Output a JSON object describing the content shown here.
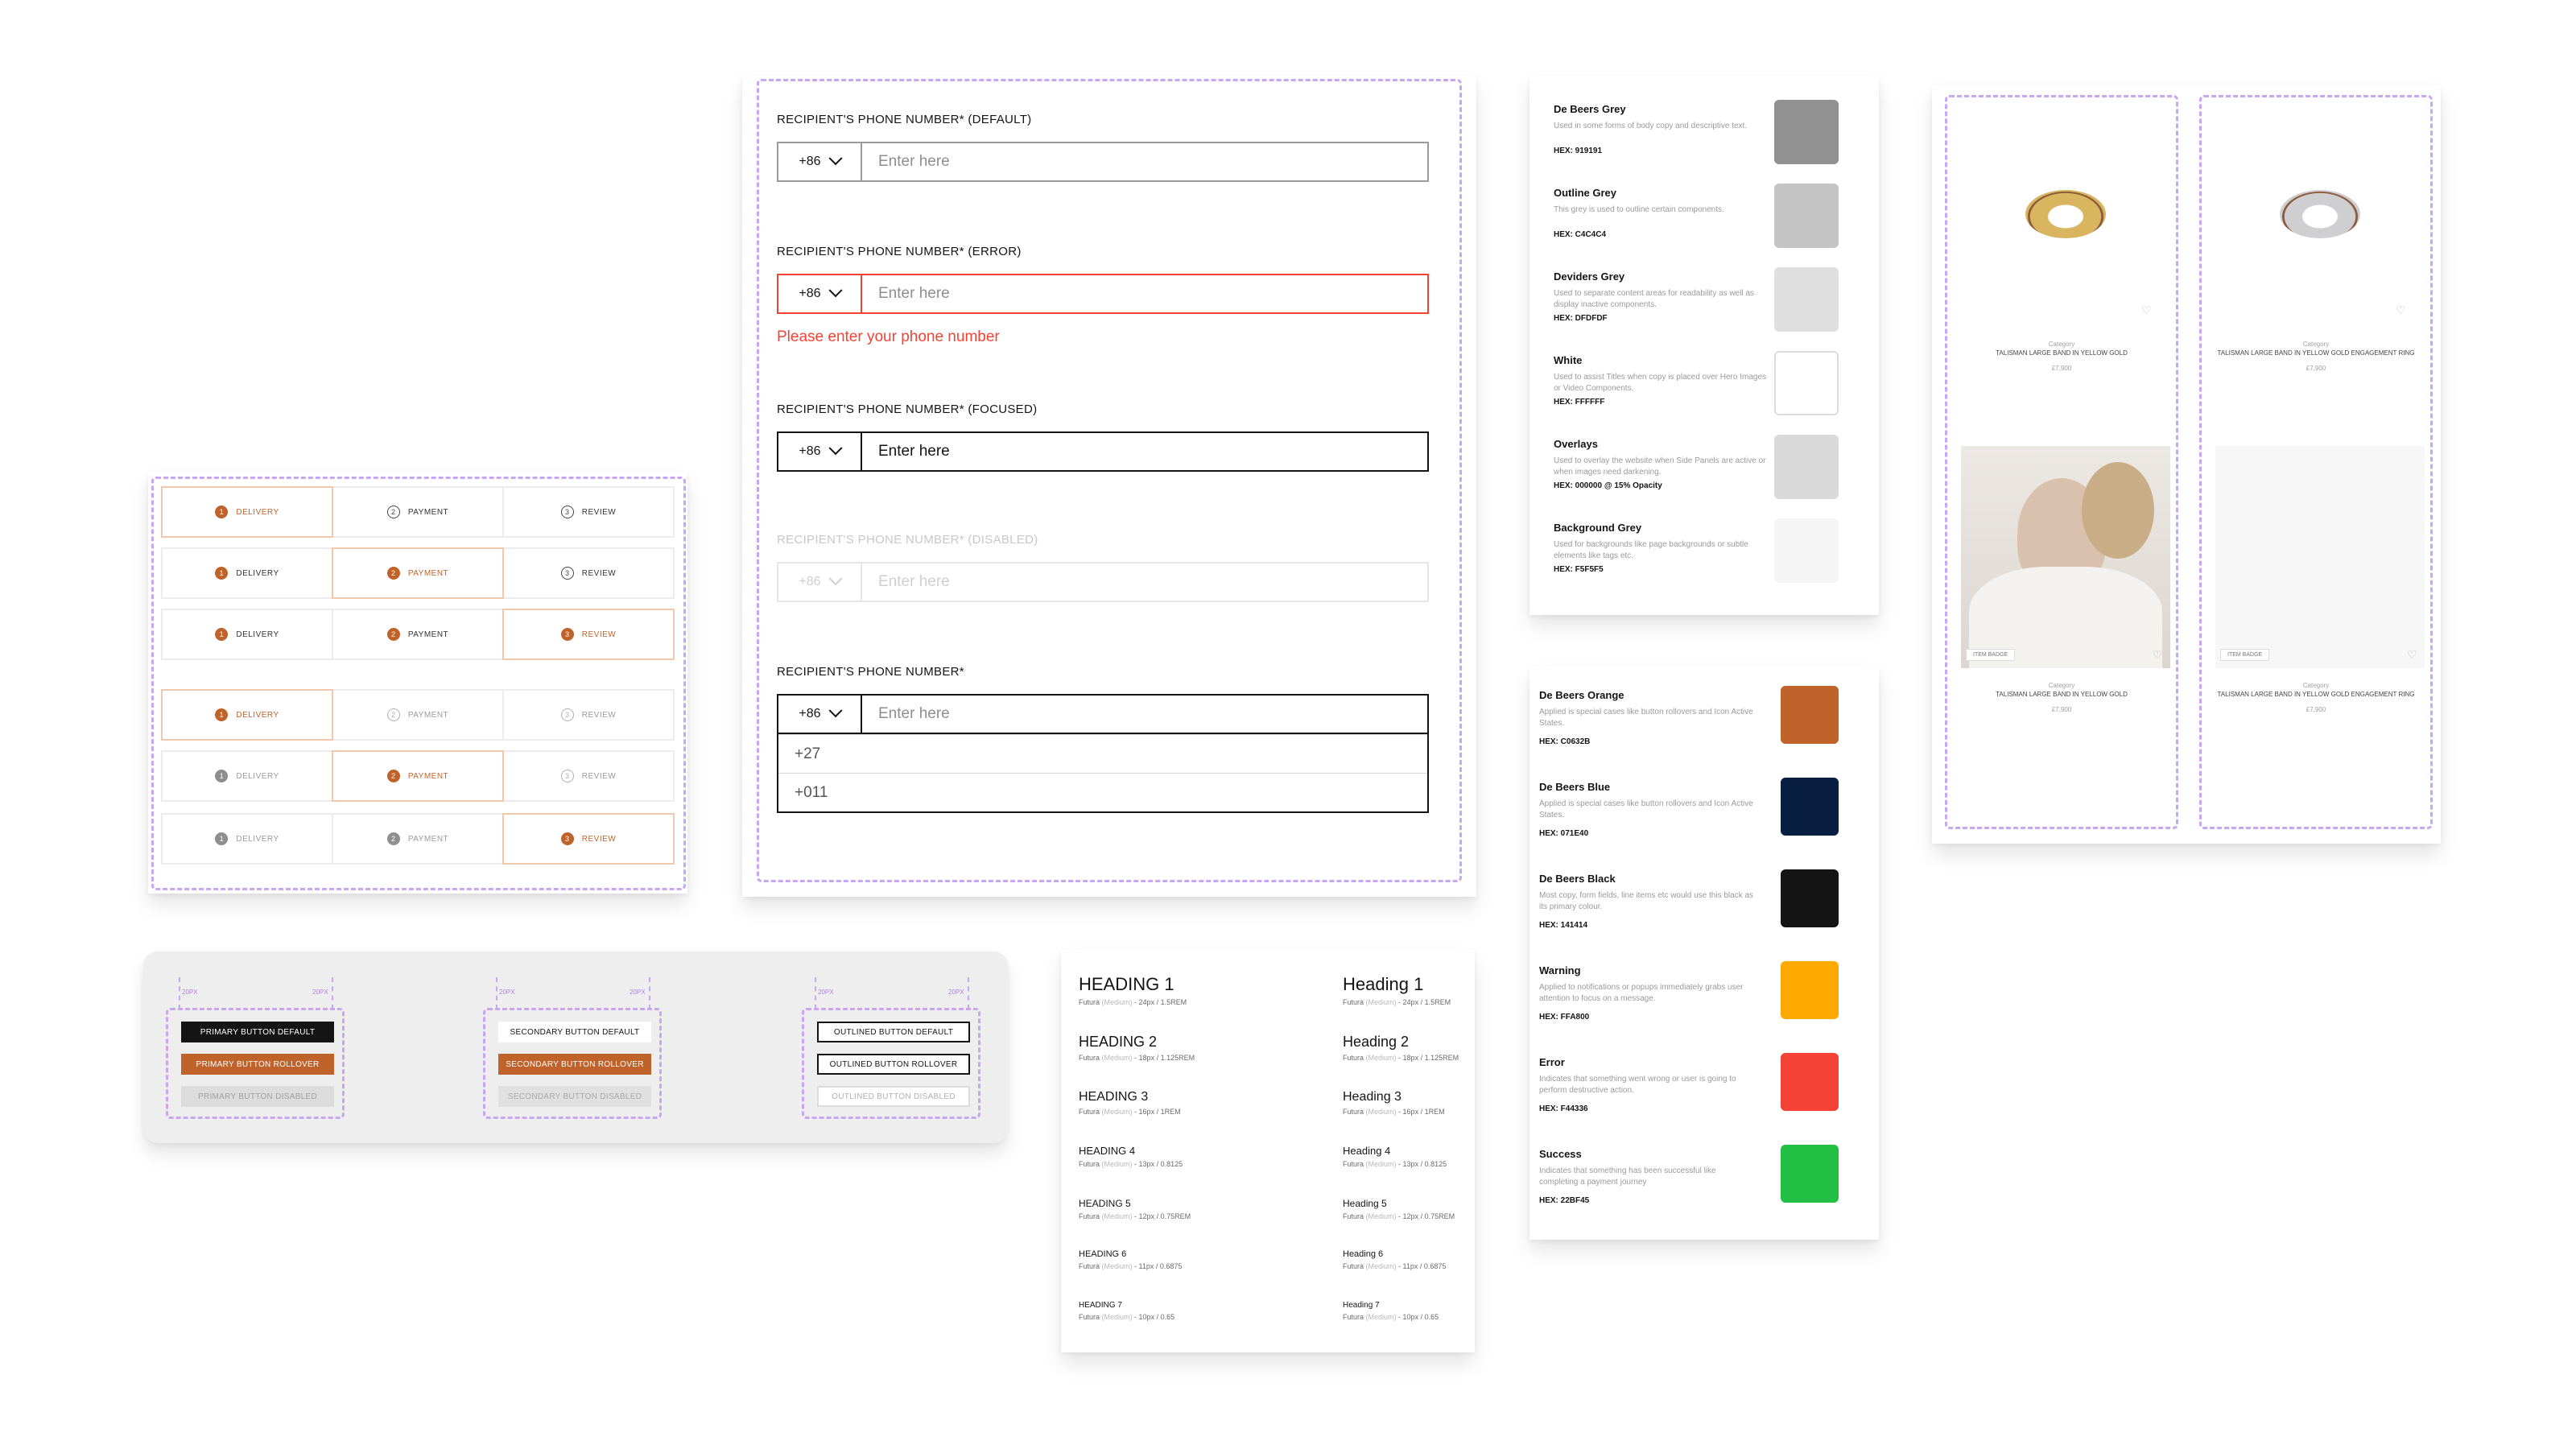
{
  "stepper": {
    "rows": [
      {
        "steps": [
          {
            "num": "1",
            "label": "DELIVERY",
            "state": "active",
            "icon": "filled"
          },
          {
            "num": "2",
            "label": "PAYMENT",
            "state": "default",
            "icon": "outline"
          },
          {
            "num": "3",
            "label": "REVIEW",
            "state": "default",
            "icon": "outline"
          }
        ]
      },
      {
        "steps": [
          {
            "num": "1",
            "label": "DELIVERY",
            "state": "done",
            "icon": "filled"
          },
          {
            "num": "2",
            "label": "PAYMENT",
            "state": "active",
            "icon": "filled"
          },
          {
            "num": "3",
            "label": "REVIEW",
            "state": "default",
            "icon": "outline"
          }
        ]
      },
      {
        "steps": [
          {
            "num": "1",
            "label": "DELIVERY",
            "state": "done",
            "icon": "filled"
          },
          {
            "num": "2",
            "label": "PAYMENT",
            "state": "done",
            "icon": "filled"
          },
          {
            "num": "3",
            "label": "REVIEW",
            "state": "active",
            "icon": "filled"
          }
        ]
      },
      {
        "steps": [
          {
            "num": "1",
            "label": "DELIVERY",
            "state": "active",
            "icon": "filled"
          },
          {
            "num": "2",
            "label": "PAYMENT",
            "state": "muted",
            "icon": "outline-light"
          },
          {
            "num": "3",
            "label": "REVIEW",
            "state": "muted",
            "icon": "outline-light"
          }
        ]
      },
      {
        "steps": [
          {
            "num": "1",
            "label": "DELIVERY",
            "state": "muted",
            "icon": "grey"
          },
          {
            "num": "2",
            "label": "PAYMENT",
            "state": "active",
            "icon": "filled"
          },
          {
            "num": "3",
            "label": "REVIEW",
            "state": "muted",
            "icon": "outline-light"
          }
        ]
      },
      {
        "steps": [
          {
            "num": "1",
            "label": "DELIVERY",
            "state": "muted",
            "icon": "grey"
          },
          {
            "num": "2",
            "label": "PAYMENT",
            "state": "muted",
            "icon": "grey"
          },
          {
            "num": "3",
            "label": "REVIEW",
            "state": "active",
            "icon": "filled"
          }
        ]
      }
    ]
  },
  "phone_form": {
    "default": {
      "label": "RECIPIENT'S PHONE NUMBER* (DEFAULT)",
      "code": "+86",
      "placeholder": "Enter here"
    },
    "error": {
      "label": "RECIPIENT'S PHONE NUMBER* (ERROR)",
      "code": "+86",
      "placeholder": "Enter here",
      "message": "Please enter your phone number"
    },
    "focused": {
      "label": "RECIPIENT'S PHONE NUMBER* (FOCUSED)",
      "code": "+86",
      "value": "Enter here"
    },
    "disabled": {
      "label": "RECIPIENT'S PHONE NUMBER* (DISABLED)",
      "code": "+86",
      "placeholder": "Enter here"
    },
    "open": {
      "label": "RECIPIENT'S PHONE NUMBER*",
      "code": "+86",
      "placeholder": "Enter here",
      "options": [
        "+27",
        "+011"
      ]
    }
  },
  "buttons": {
    "spacing_label": "20PX",
    "primary": {
      "default": "PRIMARY BUTTON DEFAULT",
      "rollover": "PRIMARY BUTTON ROLLOVER",
      "disabled": "PRIMARY BUTTON DISABLED"
    },
    "secondary": {
      "default": "SECONDARY BUTTON DEFAULT",
      "rollover": "SECONDARY BUTTON ROLLOVER",
      "disabled": "SECONDARY BUTTON DISABLED"
    },
    "outlined": {
      "default": "OUTLINED BUTTON DEFAULT",
      "rollover": "OUTLINED BUTTON ROLLOVER",
      "disabled": "OUTLINED BUTTON DISABLED"
    }
  },
  "typography": {
    "upper": [
      {
        "title": "HEADING 1",
        "font": "Futura",
        "weight": "(Medium)",
        "size": "24px / 1.5REM"
      },
      {
        "title": "HEADING 2",
        "font": "Futura",
        "weight": "(Medium)",
        "size": "18px / 1.125REM"
      },
      {
        "title": "HEADING 3",
        "font": "Futura",
        "weight": "(Medium)",
        "size": "16px / 1REM"
      },
      {
        "title": "HEADING 4",
        "font": "Futura",
        "weight": "(Medium)",
        "size": "13px / 0.8125"
      },
      {
        "title": "HEADING 5",
        "font": "Futura",
        "weight": "(Medium)",
        "size": "12px / 0.75REM"
      },
      {
        "title": "HEADING 6",
        "font": "Futura",
        "weight": "(Medium)",
        "size": "11px / 0.6875"
      },
      {
        "title": "HEADING 7",
        "font": "Futura",
        "weight": "(Medium)",
        "size": "10px / 0.65"
      }
    ],
    "title_case": [
      {
        "title": "Heading 1",
        "font": "Futura",
        "weight": "(Medium)",
        "size": "24px / 1.5REM"
      },
      {
        "title": "Heading 2",
        "font": "Futura",
        "weight": "(Medium)",
        "size": "18px / 1.125REM"
      },
      {
        "title": "Heading 3",
        "font": "Futura",
        "weight": "(Medium)",
        "size": "16px / 1REM"
      },
      {
        "title": "Heading 4",
        "font": "Futura",
        "weight": "(Medium)",
        "size": "13px / 0.8125"
      },
      {
        "title": "Heading 5",
        "font": "Futura",
        "weight": "(Medium)",
        "size": "12px / 0.75REM"
      },
      {
        "title": "Heading 6",
        "font": "Futura",
        "weight": "(Medium)",
        "size": "11px / 0.6875"
      },
      {
        "title": "Heading 7",
        "font": "Futura",
        "weight": "(Medium)",
        "size": "10px / 0.65"
      }
    ]
  },
  "neutral_colors": [
    {
      "name": "De Beers Grey",
      "desc": "Used in some forms of body copy and descriptive text.",
      "hex": "HEX: 919191",
      "color": "#919191"
    },
    {
      "name": "Outline Grey",
      "desc": "This grey is used to outline certain components.",
      "hex": "HEX: C4C4C4",
      "color": "#C4C4C4"
    },
    {
      "name": "Deviders Grey",
      "desc": "Used to separate content areas for readability as well as display inactive components.",
      "hex": "HEX: DFDFDF",
      "color": "#DFDFDF"
    },
    {
      "name": "White",
      "desc": "Used to assist Titles when copy is placed over Hero Images or Video Components.",
      "hex": "HEX: FFFFFF",
      "color": "#FFFFFF"
    },
    {
      "name": "Overlays",
      "desc": "Used to overlay the website when Side Panels are active or when images need darkening.",
      "hex": "HEX: 000000 @ 15% Opacity",
      "color": "#D9D9D9"
    },
    {
      "name": "Background Grey",
      "desc": "Used for backgrounds like page backgrounds or subtle elements like tags etc.",
      "hex": "HEX: F5F5F5",
      "color": "#F5F5F5"
    }
  ],
  "brand_colors": [
    {
      "name": "De Beers Orange",
      "desc": "Applied is special cases like button rollovers and Icon Active States.",
      "hex": "HEX: C0632B",
      "color": "#C0632B"
    },
    {
      "name": "De Beers Blue",
      "desc": "Applied is special cases like button rollovers and Icon Active States.",
      "hex": "HEX: 071E40",
      "color": "#071E40"
    },
    {
      "name": "De Beers Black",
      "desc": "Most copy, form fields, line items etc would use this black as its primary colour.",
      "hex": "HEX: 141414",
      "color": "#141414"
    },
    {
      "name": "Warning",
      "desc": "Applied to notifications or popups immediately grabs user attention to focus on a message.",
      "hex": "HEX: FFA800",
      "color": "#FFA800"
    },
    {
      "name": "Error",
      "desc": "Indicates that something went wrong or user is going to perform destructive action.",
      "hex": "HEX: F44336",
      "color": "#F44336"
    },
    {
      "name": "Success",
      "desc": "Indicates that something has been successful like completing a payment journey",
      "hex": "HEX: 22BF45",
      "color": "#22BF45"
    }
  ],
  "products": [
    {
      "category": "Category",
      "name": "TALISMAN LARGE BAND IN YELLOW GOLD",
      "price": "£7,900",
      "ring_color": "#d9b560",
      "photo_category": "Category",
      "photo_name": "TALISMAN LARGE BAND IN YELLOW GOLD",
      "photo_price": "£7,900",
      "badge": "ITEM BADGE"
    },
    {
      "category": "Category",
      "name": "TALISMAN LARGE BAND IN YELLOW GOLD ENGAGEMENT RING",
      "price": "£7,900",
      "ring_color": "#cfcfd2",
      "photo_category": "Category",
      "photo_name": "TALISMAN LARGE BAND IN YELLOW GOLD ENGAGEMENT RING",
      "photo_price": "£7,900",
      "badge": "ITEM BADGE"
    }
  ]
}
